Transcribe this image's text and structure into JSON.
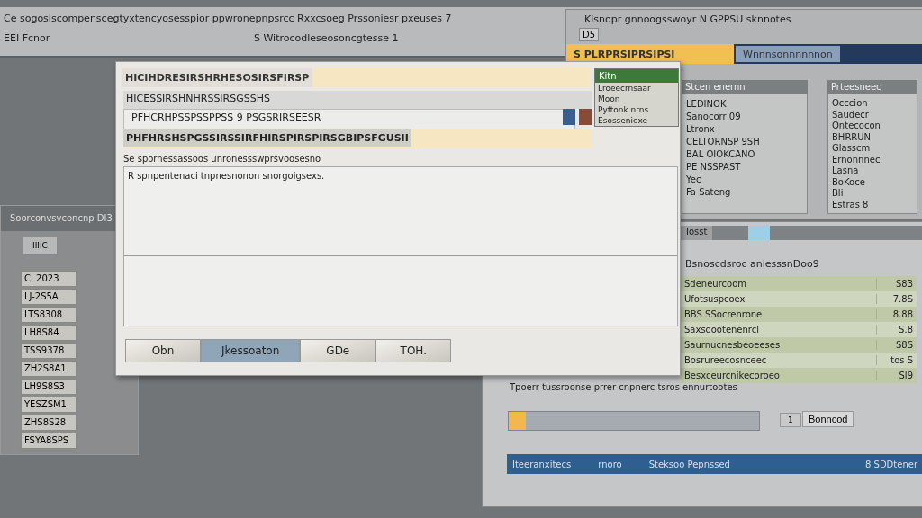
{
  "top_window": {
    "title": "Ce sogosiscompenscegtyxtencyosesspior ppwronepnpsrcc Rxxcsoeg Prssoniesr pxeuses 7",
    "menu_label": "EEI Fcnor",
    "subtitle": "S Witrocodleseosoncgtesse 1"
  },
  "right_window": {
    "title": "Kisnopr gnnoogsswoyr N GPPSU sknnotes",
    "badge": "D5",
    "tabs": [
      {
        "label": "S PLRPRSIPRSIPSI",
        "selected": true
      },
      {
        "label": "Wnnnsonnnnnnon",
        "selected": false
      }
    ],
    "side_panel": {
      "header": "Kitn",
      "items": [
        "Lroeecrnsaar",
        "Moon",
        "Pyftonk nrns",
        "Esosseniexe"
      ]
    },
    "list_header": "Stcen enernn",
    "items": [
      "LEDINOK",
      "Sanocorr 09",
      "Ltronx",
      "CELTORNSP 9SH",
      "BAL OIOKCANO",
      "PE NSSPAST",
      "Yec",
      "Fa Sateng"
    ],
    "list2_header": "Prteesneec",
    "items2": [
      "Occcion",
      "Saudecr",
      "Ontecocon",
      "BHRRUN",
      "Glasscm",
      "Ernonnnec",
      "Lasna",
      "BoKoce",
      "Bli",
      "Estras 8"
    ]
  },
  "left_panel": {
    "header": "Soorconvsvconcnp DI3",
    "control": "IIIIC",
    "cells": [
      "CI 2023",
      "LJ-2S5A",
      "LTS8308",
      "LH8S84",
      "TSS9378",
      "ZH2S8A1",
      "LH9S8S3",
      "YESZSM1",
      "ZHS8S28",
      "FSYA8SPS"
    ]
  },
  "results_window": {
    "tab": "Iosst",
    "heading": "Bsnoscdsroc aniesssnDoo9",
    "rows": [
      {
        "name": "Sdeneurcoom",
        "value": "S83"
      },
      {
        "name": "Ufotsuspcoex",
        "value": "7.8S"
      },
      {
        "name": "BBS SSocrenrone",
        "value": "8.88"
      },
      {
        "name": "Saxsoootenenrcl",
        "value": "S.8"
      },
      {
        "name": "Saurnucnesbeoeeses",
        "value": "S8S"
      },
      {
        "name": "Bosrureecosnceec",
        "value": "tos S"
      },
      {
        "name": "Besxceurcnikecoroeo",
        "value": "Sl9"
      }
    ],
    "footer": "Tpoerr tussroonse prrer cnpnerc tsros ennurtootes",
    "progress": {
      "level": 0.07
    },
    "count": "1",
    "action": "Bonncod",
    "status_bar": [
      "Iteeranxitecs",
      "rnoro",
      "Steksoo Pepnssed",
      "8 SDDtener"
    ]
  },
  "dialog": {
    "title": "HICIHDRESIRSHRHESOSIRSFIRSP",
    "field_1": "HICESSIRSHNHRSSIRSGSSHS",
    "field_2": "PFHCRHPSSPSSPPSS 9 PSGSRIRSEESR",
    "field_3": "PHFHRSHSPGSSIRSSIRFHIRSPIRSPIRSGBIPSFGUSII",
    "section": "Se spornessassoos unronessswprsvoosesno",
    "message": "R spnpentenaci tnpnesnonon snorgoigsexs.",
    "buttons": [
      {
        "label": "Obn",
        "selected": false
      },
      {
        "label": "Jkessoaton",
        "selected": true
      },
      {
        "label": "GDe",
        "selected": false
      },
      {
        "label": "TOH.",
        "selected": false
      }
    ]
  }
}
